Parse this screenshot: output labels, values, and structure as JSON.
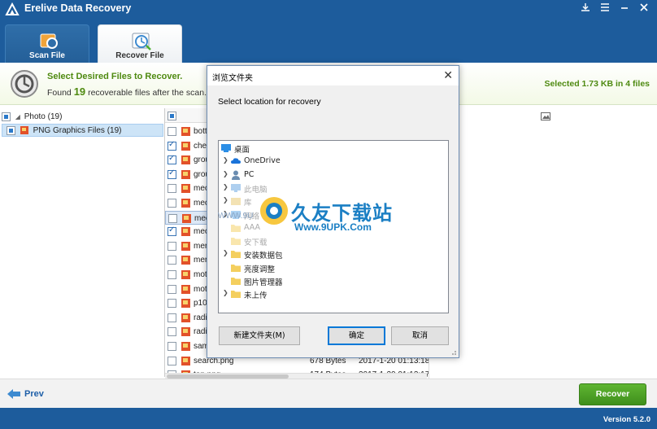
{
  "app": {
    "title": "Erelive Data Recovery",
    "version": "Version 5.2.0"
  },
  "window_controls": [
    "download-icon",
    "settings-icon",
    "minimize-icon",
    "maximize-icon",
    "close-icon"
  ],
  "tabs": [
    {
      "label": "Scan File",
      "icon": "scan-icon",
      "active": false
    },
    {
      "label": "Recover File",
      "icon": "recover-icon",
      "active": true
    }
  ],
  "info": {
    "heading": "Select Desired Files to Recover.",
    "found_prefix": "Found",
    "found_count": "19",
    "found_suffix": "recoverable files after the scan. Please",
    "selected_text": "Selected 1.73 KB in 4 files"
  },
  "tree": {
    "items": [
      {
        "label": "Photo (19)",
        "state": "partial"
      },
      {
        "label": "PNG Graphics Files (19)",
        "state": "partial"
      }
    ]
  },
  "files": [
    {
      "name": "bott",
      "checked": false,
      "size": "",
      "date": ""
    },
    {
      "name": "chec",
      "checked": true,
      "size": "",
      "date": ""
    },
    {
      "name": "grou",
      "checked": true,
      "size": "",
      "date": ""
    },
    {
      "name": "grou",
      "checked": true,
      "size": "",
      "date": ""
    },
    {
      "name": "mec",
      "checked": false,
      "size": "",
      "date": ""
    },
    {
      "name": "mec",
      "checked": false,
      "size": "",
      "date": ""
    },
    {
      "name": "mec",
      "checked": false,
      "size": "",
      "date": ""
    },
    {
      "name": "mec",
      "checked": true,
      "size": "",
      "date": ""
    },
    {
      "name": "mer",
      "checked": false,
      "size": "",
      "date": ""
    },
    {
      "name": "mer",
      "checked": false,
      "size": "",
      "date": ""
    },
    {
      "name": "mot",
      "checked": false,
      "size": "",
      "date": ""
    },
    {
      "name": "mot",
      "checked": false,
      "size": "",
      "date": ""
    },
    {
      "name": "p10",
      "checked": false,
      "size": "",
      "date": ""
    },
    {
      "name": "radi",
      "checked": false,
      "size": "",
      "date": ""
    },
    {
      "name": "radi",
      "checked": false,
      "size": "",
      "date": ""
    },
    {
      "name": "sam",
      "checked": false,
      "size": "",
      "date": ""
    },
    {
      "name": "search.png",
      "checked": false,
      "size": "678 Bytes",
      "date": "2017-1-20 01:13:18"
    },
    {
      "name": "top.png",
      "checked": false,
      "size": "174 Bytes",
      "date": "2017-1-20 01:13:17"
    }
  ],
  "bottom": {
    "prev_label": "Prev",
    "recover_label": "Recover"
  },
  "dialog": {
    "title": "浏览文件夹",
    "prompt": "Select location for recovery",
    "items": [
      {
        "label": "桌面",
        "icon": "desktop-icon",
        "expand": false,
        "faded": false
      },
      {
        "label": "OneDrive",
        "icon": "onedrive-icon",
        "expand": true,
        "faded": false
      },
      {
        "label": "PC",
        "icon": "user-icon",
        "expand": true,
        "faded": false
      },
      {
        "label": "此电脑",
        "icon": "computer-icon",
        "expand": true,
        "faded": true
      },
      {
        "label": "库",
        "icon": "library-icon",
        "expand": true,
        "faded": true
      },
      {
        "label": "网络",
        "icon": "network-icon",
        "expand": true,
        "faded": true
      },
      {
        "label": "AAA",
        "icon": "folder-icon",
        "expand": false,
        "faded": true
      },
      {
        "label": "安下载",
        "icon": "folder-icon",
        "expand": false,
        "faded": true
      },
      {
        "label": "安装数据包",
        "icon": "folder-icon",
        "expand": true,
        "faded": false
      },
      {
        "label": "亮度调整",
        "icon": "folder-icon",
        "expand": false,
        "faded": false
      },
      {
        "label": "图片管理器",
        "icon": "folder-icon",
        "expand": false,
        "faded": false
      },
      {
        "label": "未上传",
        "icon": "folder-icon",
        "expand": true,
        "faded": false
      }
    ],
    "new_folder_label": "新建文件夹(M)",
    "ok_label": "确定",
    "cancel_label": "取消"
  },
  "watermark": {
    "text": "久友下载站",
    "url": "Www.9UPK.Com",
    "left_text": "WWW.9U"
  },
  "colors": {
    "brand_blue": "#1d5c9c",
    "accent_green": "#4f8a11",
    "recover_button": "#4da526"
  }
}
